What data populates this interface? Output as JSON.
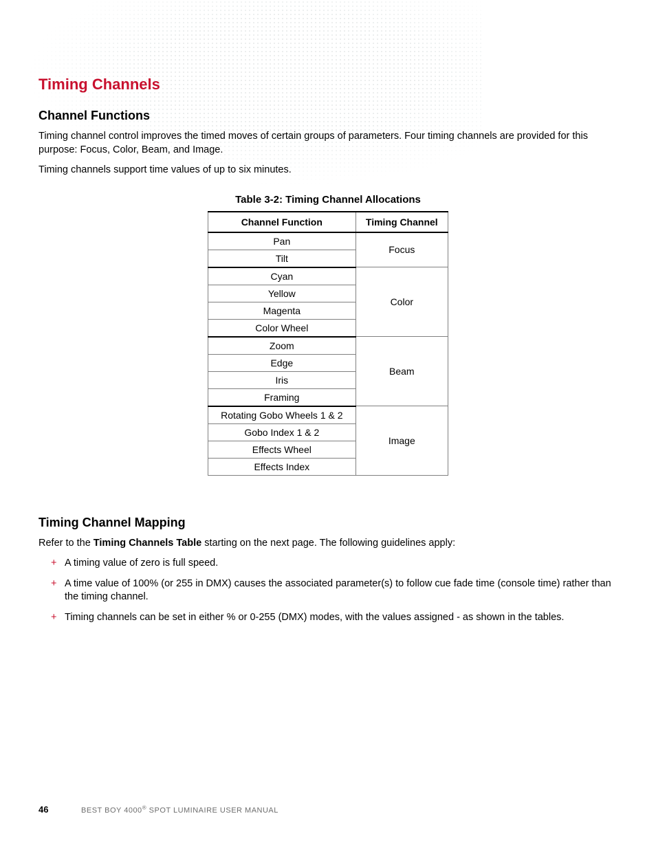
{
  "section": {
    "title": "Timing Channels",
    "channel_functions": {
      "heading": "Channel Functions",
      "p1": "Timing channel control improves the timed moves of certain groups of parameters. Four timing channels are provided for this purpose: Focus, Color, Beam, and Image.",
      "p2": "Timing channels support time values of up to six minutes."
    },
    "table": {
      "caption": "Table 3-2: Timing Channel Allocations",
      "header": {
        "c1": "Channel Function",
        "c2": "Timing Channel"
      },
      "groups": [
        {
          "timing": "Focus",
          "functions": [
            "Pan",
            "Tilt"
          ]
        },
        {
          "timing": "Color",
          "functions": [
            "Cyan",
            "Yellow",
            "Magenta",
            "Color Wheel"
          ]
        },
        {
          "timing": "Beam",
          "functions": [
            "Zoom",
            "Edge",
            "Iris",
            "Framing"
          ]
        },
        {
          "timing": "Image",
          "functions": [
            "Rotating Gobo Wheels 1 & 2",
            "Gobo Index 1 & 2",
            "Effects Wheel",
            "Effects Index"
          ]
        }
      ]
    },
    "mapping": {
      "heading": "Timing Channel Mapping",
      "intro_prefix": "Refer to the ",
      "intro_bold": "Timing Channels Table",
      "intro_suffix": " starting on the next page. The following guidelines apply:",
      "bullets": [
        "A timing value of zero is full speed.",
        "A time value of 100% (or 255 in DMX) causes the associated parameter(s) to follow cue fade time (console time) rather than the timing channel.",
        "Timing channels can be set in either % or 0-255 (DMX) modes, with the values assigned - as shown in the tables."
      ]
    }
  },
  "footer": {
    "page": "46",
    "product_prefix": "BEST BOY 4000",
    "product_suffix": " SPOT LUMINAIRE USER MANUAL"
  }
}
